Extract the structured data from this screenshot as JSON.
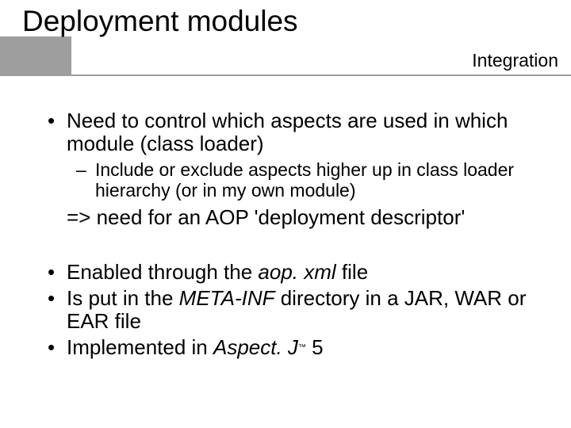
{
  "header": {
    "title": "Deployment modules",
    "subtitle": "Integration"
  },
  "body": {
    "b1": "Need to control which aspects are used in which module (class loader)",
    "s1": "Include or exclude aspects higher up in class loader hierarchy (or in my own module)",
    "arrow": "=> need for an AOP 'deployment descriptor'",
    "b2_a": "Enabled through the ",
    "b2_file": "aop. xml",
    "b2_c": " file",
    "b3_a": "Is put in the ",
    "b3_dir": "META-INF",
    "b3_b": " directory in a JAR, WAR or EAR file",
    "b4_a": "Implemented in ",
    "b4_name": "Aspect. J",
    "b4_tm": "™",
    "b4_ver": " 5"
  }
}
